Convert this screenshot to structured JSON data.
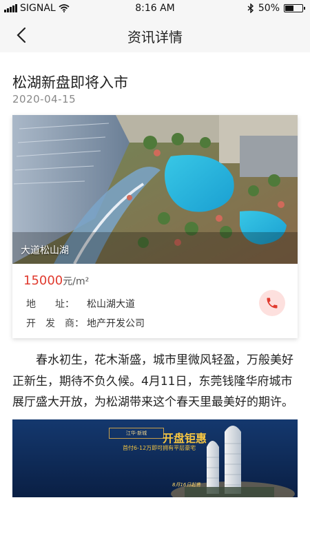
{
  "status_bar": {
    "carrier": "SIGNAL",
    "time": "8:16 AM",
    "battery_percent": "50%",
    "battery_level": 0.5
  },
  "nav": {
    "title": "资讯详情",
    "back_icon": "chevron-left-icon"
  },
  "article": {
    "title": "松湖新盘即将入市",
    "date": "2020-04-15",
    "body": "春水初生，花木渐盛，城市里微风轻盈，万般美好正新生，期待不负久候。4月11日，东莞钱隆华府城市展厅盛大开放，为松湖带来这个春天里最美好的期许。"
  },
  "property": {
    "image_caption": "大道松山湖",
    "price_value": "15000",
    "price_unit": "元/m²",
    "address_label": "地　　址：",
    "address_value": "松山湖大道",
    "developer_label": "开　发　商：",
    "developer_value": "地产开发公司",
    "call_icon": "phone-icon"
  },
  "banner": {
    "headline": "开盘钜惠",
    "subline": "首付6-12万即可拥有平层豪宅",
    "date": "8月16日起售",
    "logo_text": "江华·新城"
  },
  "colors": {
    "accent_red": "#e03a2e",
    "nav_bg": "#f6f6f6",
    "call_bg": "#fde0de"
  }
}
